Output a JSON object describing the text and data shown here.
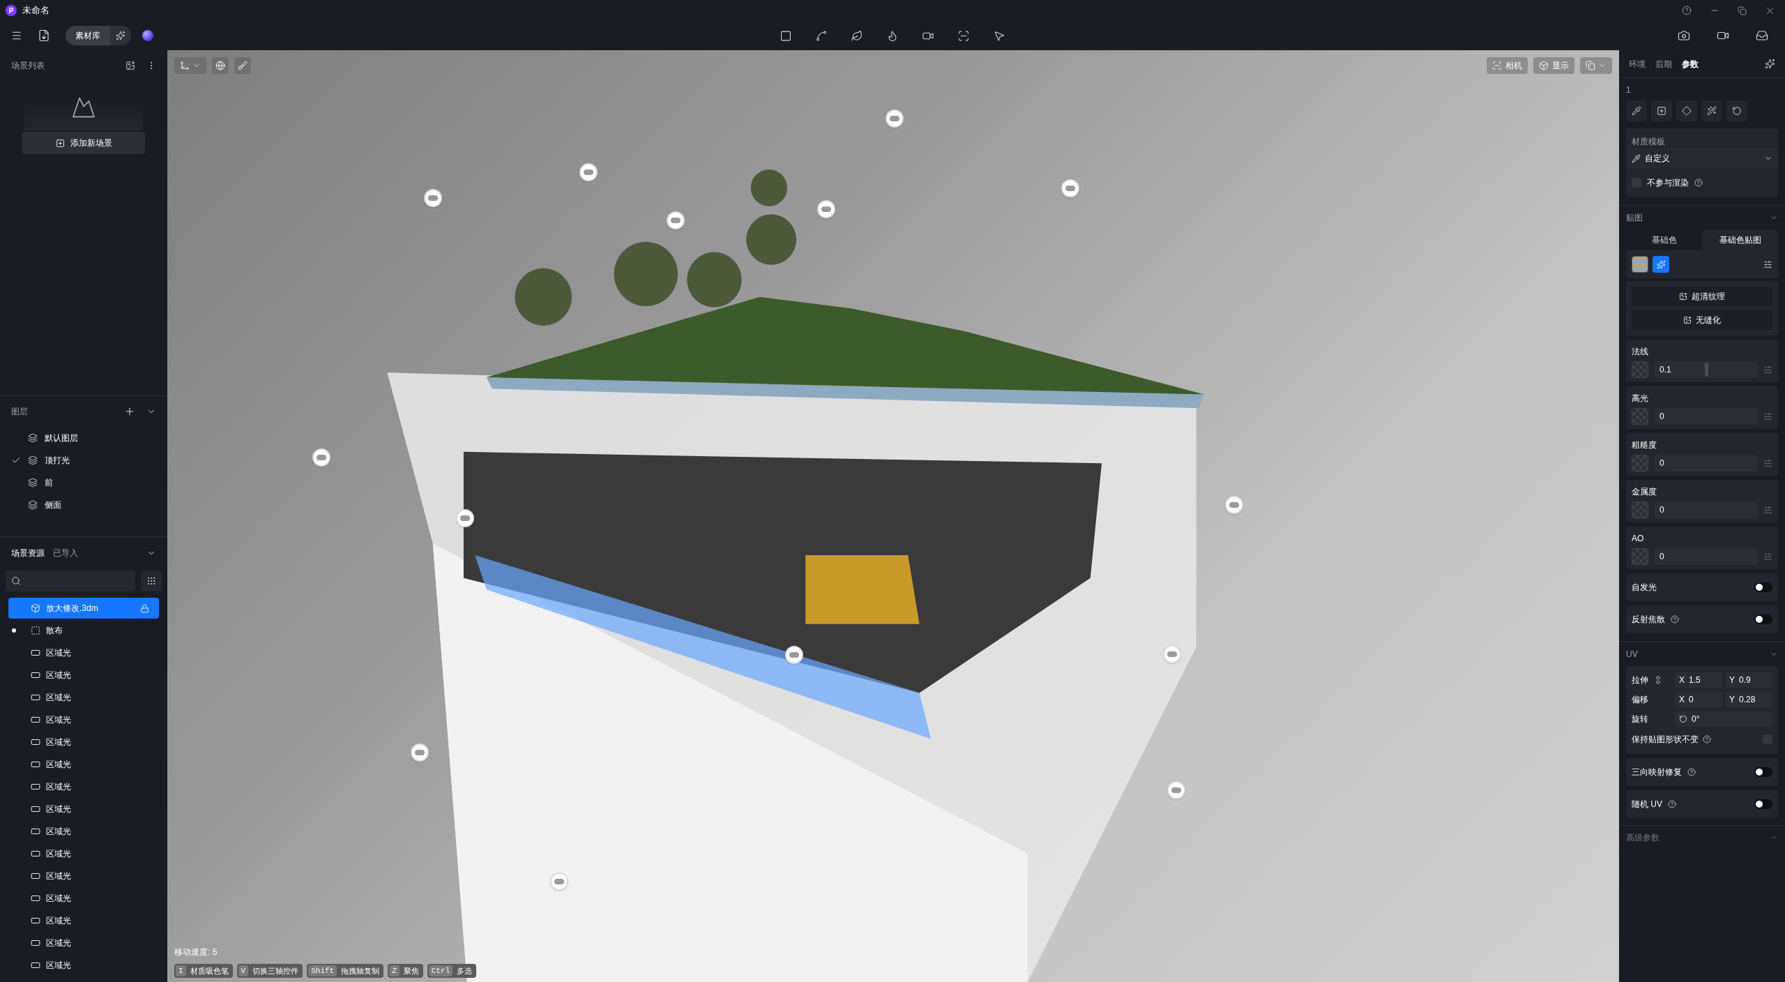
{
  "window": {
    "logo": "P",
    "title": "未命名"
  },
  "toolbar": {
    "library": "素材库"
  },
  "scene_list": {
    "title": "场景列表",
    "add_button": "添加新场景"
  },
  "layers": {
    "title": "图层",
    "items": [
      {
        "label": "默认图层",
        "checked": false
      },
      {
        "label": "顶打光",
        "checked": true
      },
      {
        "label": "前",
        "checked": false
      },
      {
        "label": "侧面",
        "checked": false
      }
    ]
  },
  "resources": {
    "tabs": [
      {
        "label": "场景资源",
        "selected": true
      },
      {
        "label": "已导入",
        "selected": false
      }
    ],
    "items": [
      {
        "kind": "model",
        "label": "放大修改.3dm",
        "selected": true,
        "locked": true,
        "marked": false
      },
      {
        "kind": "scatter",
        "label": "散布",
        "selected": false,
        "locked": false,
        "marked": true
      },
      {
        "kind": "area_light",
        "label": "区域光",
        "selected": false,
        "locked": false,
        "marked": false
      },
      {
        "kind": "area_light",
        "label": "区域光",
        "selected": false,
        "locked": false,
        "marked": false
      },
      {
        "kind": "area_light",
        "label": "区域光",
        "selected": false,
        "locked": false,
        "marked": false
      },
      {
        "kind": "area_light",
        "label": "区域光",
        "selected": false,
        "locked": false,
        "marked": false
      },
      {
        "kind": "area_light",
        "label": "区域光",
        "selected": false,
        "locked": false,
        "marked": false
      },
      {
        "kind": "area_light",
        "label": "区域光",
        "selected": false,
        "locked": false,
        "marked": false
      },
      {
        "kind": "area_light",
        "label": "区域光",
        "selected": false,
        "locked": false,
        "marked": false
      },
      {
        "kind": "area_light",
        "label": "区域光",
        "selected": false,
        "locked": false,
        "marked": false
      },
      {
        "kind": "area_light",
        "label": "区域光",
        "selected": false,
        "locked": false,
        "marked": false
      },
      {
        "kind": "area_light",
        "label": "区域光",
        "selected": false,
        "locked": false,
        "marked": false
      },
      {
        "kind": "area_light",
        "label": "区域光",
        "selected": false,
        "locked": false,
        "marked": false
      },
      {
        "kind": "area_light",
        "label": "区域光",
        "selected": false,
        "locked": false,
        "marked": false
      },
      {
        "kind": "area_light",
        "label": "区域光",
        "selected": false,
        "locked": false,
        "marked": false
      },
      {
        "kind": "area_light",
        "label": "区域光",
        "selected": false,
        "locked": false,
        "marked": false
      },
      {
        "kind": "area_light",
        "label": "区域光",
        "selected": false,
        "locked": false,
        "marked": false
      }
    ]
  },
  "viewport": {
    "camera_button": "相机",
    "display_button": "显示",
    "move_speed": "移动速度: 5",
    "shortcuts": [
      {
        "key": "I",
        "action": "材质吸色笔"
      },
      {
        "key": "V",
        "action": "切换三轴控件"
      },
      {
        "key": "Shift",
        "action": "拖拽轴复制"
      },
      {
        "key": "Z",
        "action": "聚焦"
      },
      {
        "key": "Ctrl",
        "action": "多选"
      }
    ]
  },
  "inspector": {
    "tabs": [
      {
        "label": "环境",
        "selected": false
      },
      {
        "label": "后期",
        "selected": false
      },
      {
        "label": "参数",
        "selected": true
      }
    ],
    "material_name": "1",
    "template": {
      "label": "材质模板",
      "value": "自定义"
    },
    "exclude_render": {
      "label": "不参与渲染",
      "checked": false
    },
    "maps": {
      "title": "贴图",
      "expanded": true,
      "tabs": [
        {
          "label": "基础色",
          "selected": false
        },
        {
          "label": "基础色贴图",
          "selected": true
        }
      ],
      "buttons": [
        "超清纹理",
        "无缝化"
      ],
      "params": [
        {
          "label": "法线",
          "value": "0.1",
          "level": 0.5
        },
        {
          "label": "高光",
          "value": "0"
        },
        {
          "label": "粗糙度",
          "value": "0"
        },
        {
          "label": "金属度",
          "value": "0"
        },
        {
          "label": "AO",
          "value": "0"
        }
      ],
      "toggles": [
        {
          "label": "自发光",
          "help": false,
          "on": false
        },
        {
          "label": "反射焦散",
          "help": true,
          "on": false
        }
      ]
    },
    "uv": {
      "title": "UV",
      "expanded": true,
      "stretch": {
        "label": "拉伸",
        "x": "X",
        "x_value": "1.5",
        "y": "Y",
        "y_value": "0.9"
      },
      "offset": {
        "label": "偏移",
        "x": "X",
        "x_value": "0",
        "y": "Y",
        "y_value": "0.28"
      },
      "rotate": {
        "label": "旋转",
        "value": "0°"
      },
      "keep_shape": {
        "label": "保持贴图形状不变",
        "checked": false
      },
      "toggles": [
        {
          "label": "三向映射修复",
          "on": false
        },
        {
          "label": "随机 UV",
          "on": false
        }
      ]
    },
    "advanced": {
      "title": "高级参数",
      "expanded": false
    }
  }
}
